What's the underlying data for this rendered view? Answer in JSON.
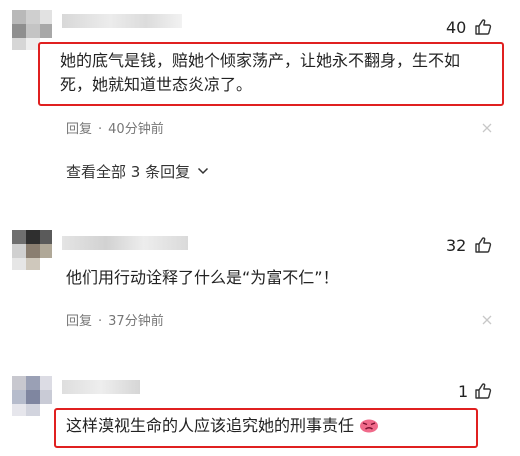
{
  "comments": [
    {
      "likes": "40",
      "text": "她的底气是钱，赔她个倾家荡产，让她永不翻身，生不如死，她就知道世态炎凉了。",
      "reply_label": "回复",
      "dot": "·",
      "time": "40分钟前",
      "view_all": "查看全部 3 条回复"
    },
    {
      "likes": "32",
      "text": "他们用行动诠释了什么是“为富不仁”！",
      "reply_label": "回复",
      "dot": "·",
      "time": "37分钟前"
    },
    {
      "likes": "1",
      "text": "这样漠视生命的人应该追究她的刑事责任",
      "emoji": "angry-face-emoji"
    }
  ],
  "colors": {
    "highlight": "#e02020",
    "meta": "#777777"
  },
  "icons": [
    "thumbs-up-icon",
    "close-icon",
    "chevron-down-icon"
  ]
}
